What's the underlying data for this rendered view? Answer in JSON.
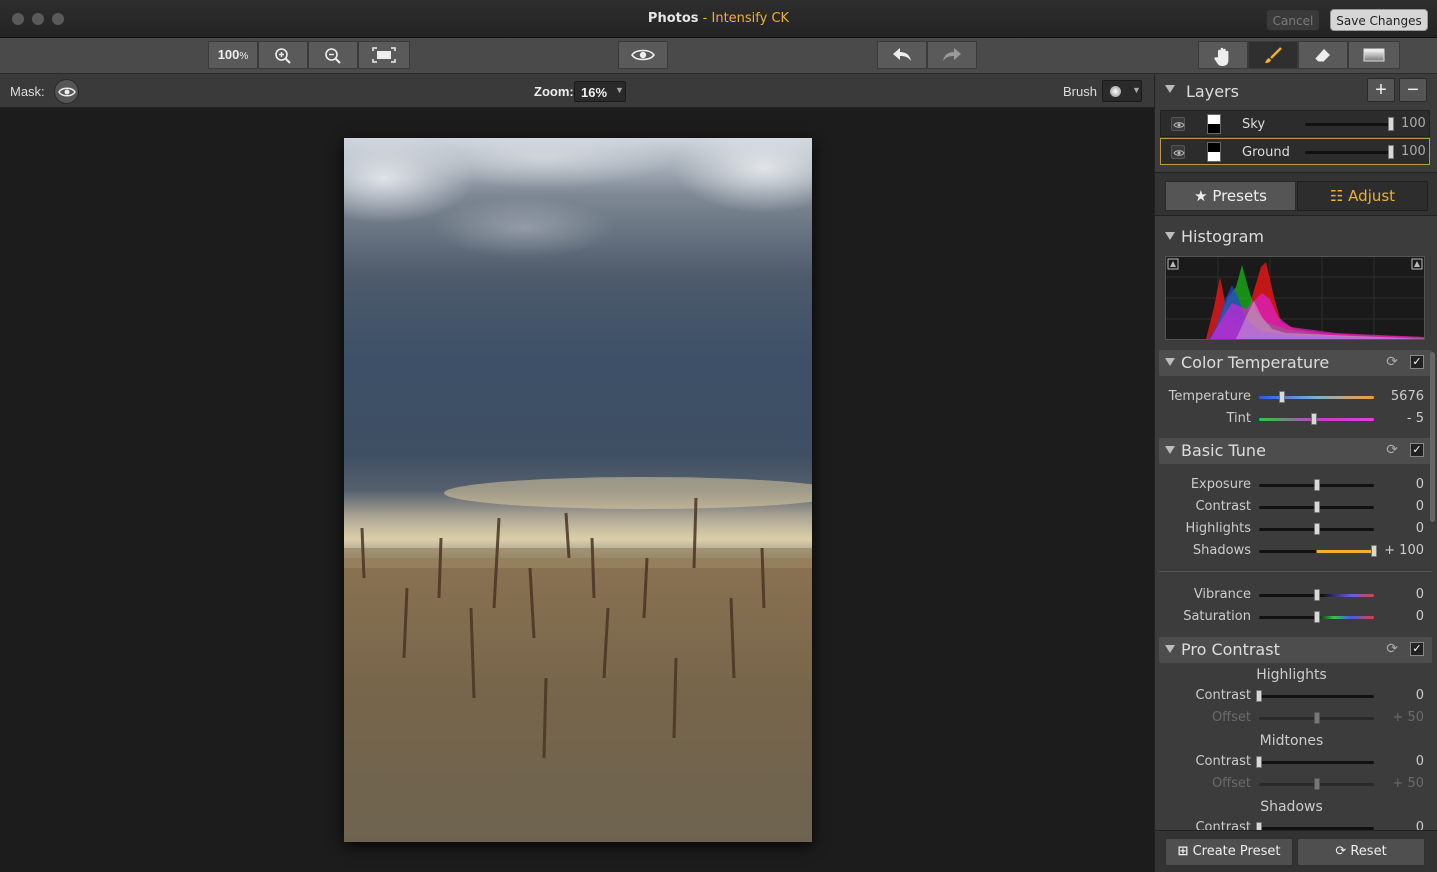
{
  "window": {
    "title_main": "Photos",
    "title_separator": " - ",
    "title_app": "Intensify CK",
    "cancel_label": "Cancel",
    "save_label": "Save Changes"
  },
  "toolbar": {
    "zoom_100_label": "100",
    "zoom_100_suffix": "%"
  },
  "subbar": {
    "mask_label": "Mask:",
    "zoom_label": "Zoom:",
    "zoom_value": "16%",
    "brush_label": "Brush"
  },
  "layers": {
    "title": "Layers",
    "items": [
      {
        "name": "Sky",
        "opacity": "100",
        "level": 1.0
      },
      {
        "name": "Ground",
        "opacity": "100",
        "level": 1.0
      }
    ]
  },
  "tabs": {
    "presets_label": "Presets",
    "adjust_label": "Adjust"
  },
  "histogram": {
    "title": "Histogram"
  },
  "color_temperature": {
    "title": "Color Temperature",
    "rows": [
      {
        "name": "Temperature",
        "value": "5676",
        "level": 0.2
      },
      {
        "name": "Tint",
        "value": "- 5",
        "level": 0.48
      }
    ]
  },
  "basic_tune": {
    "title": "Basic Tune",
    "rows": [
      {
        "name": "Exposure",
        "value": "0",
        "level": 0.5
      },
      {
        "name": "Contrast",
        "value": "0",
        "level": 0.5
      },
      {
        "name": "Highlights",
        "value": "0",
        "level": 0.5
      },
      {
        "name": "Shadows",
        "value": "+ 100",
        "level": 1.0
      },
      {
        "name": "Vibrance",
        "value": "0",
        "level": 0.5
      },
      {
        "name": "Saturation",
        "value": "0",
        "level": 0.5
      }
    ]
  },
  "pro_contrast": {
    "title": "Pro Contrast",
    "highlights_label": "Highlights",
    "midtones_label": "Midtones",
    "shadows_label": "Shadows",
    "rows": [
      {
        "name": "Contrast",
        "value": "0",
        "level": 0.0
      },
      {
        "name": "Offset",
        "value": "+ 50",
        "level": 0.5
      },
      {
        "name": "Contrast",
        "value": "0",
        "level": 0.0
      },
      {
        "name": "Offset",
        "value": "+ 50",
        "level": 0.5
      },
      {
        "name": "Contrast",
        "value": "0",
        "level": 0.0
      }
    ]
  },
  "footer": {
    "create_preset_label": "Create Preset",
    "reset_label": "Reset"
  },
  "colors": {
    "accent": "#f0b030",
    "panel": "#3c3c3c"
  }
}
